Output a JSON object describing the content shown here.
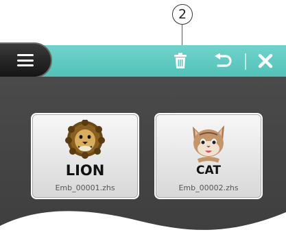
{
  "callout": {
    "number": "2"
  },
  "toolbar": {
    "menu_icon": "hamburger-menu-icon",
    "delete_icon": "trash-icon",
    "undo_icon": "undo-icon",
    "close_icon": "close-icon",
    "accent_color": "#5ccac0"
  },
  "files": [
    {
      "label": "LION",
      "filename": "Emb_00001.zhs",
      "image": "lion-embroidery"
    },
    {
      "label": "CAT",
      "filename": "Emb_00002.zhs",
      "image": "cat-embroidery"
    }
  ]
}
